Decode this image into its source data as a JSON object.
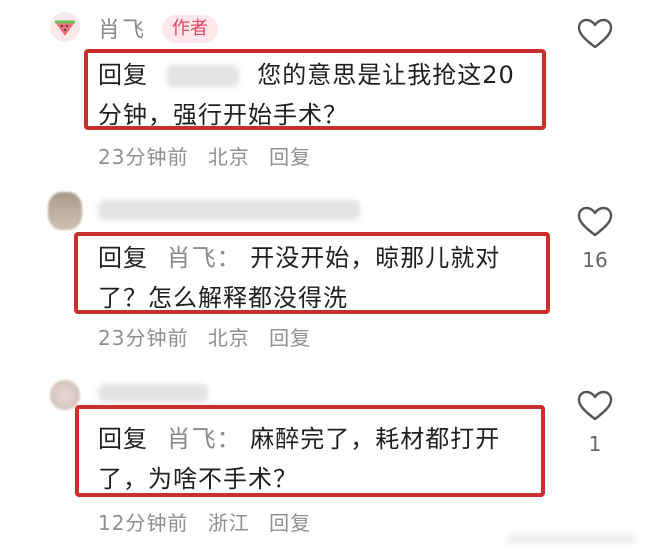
{
  "comments": [
    {
      "author": "肖飞",
      "author_tag": "作者",
      "reply_prefix": "回复",
      "line1": "您的意思是让我抢这20",
      "line2": "分钟，强行开始手术？",
      "time": "23分钟前",
      "location": "北京",
      "reply_action": "回复"
    },
    {
      "reply_prefix": "回复",
      "reply_to": "肖飞：",
      "line1": "开没开始，晾那儿就对",
      "line2": "了？怎么解释都没得洗",
      "time": "23分钟前",
      "location": "北京",
      "reply_action": "回复",
      "likes": "16"
    },
    {
      "reply_prefix": "回复",
      "reply_to": "肖飞：",
      "line1": "麻醉完了，耗材都打开",
      "line2": "了，为啥不手术？",
      "time": "12分钟前",
      "location": "浙江",
      "reply_action": "回复",
      "likes": "1"
    }
  ],
  "colors": {
    "highlight_border": "#c9302c",
    "author_tag_bg": "#fde7ea",
    "author_tag_text": "#e4465f",
    "meta_text": "#8f8f8f"
  },
  "icons": [
    "watermelon-avatar-icon",
    "heart-outline-icon"
  ]
}
